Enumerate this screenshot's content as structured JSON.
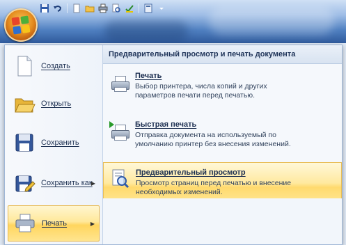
{
  "menu": {
    "items": [
      {
        "label": "Создать",
        "icon": "new-document-icon"
      },
      {
        "label": "Открыть",
        "icon": "open-folder-icon"
      },
      {
        "label": "Сохранить",
        "icon": "save-icon"
      },
      {
        "label": "Сохранить как",
        "icon": "save-as-icon",
        "has_submenu": true
      },
      {
        "label": "Печать",
        "icon": "printer-icon",
        "has_submenu": true,
        "active": true
      }
    ]
  },
  "submenu": {
    "title": "Предварительный просмотр и печать документа",
    "items": [
      {
        "title": "Печать",
        "description": "Выбор принтера, числа копий и других параметров печати перед печатью.",
        "icon": "printer-icon"
      },
      {
        "title": "Быстрая печать",
        "description": "Отправка документа на используемый по умолчанию принтер без внесения изменений.",
        "icon": "quick-print-icon"
      },
      {
        "title": "Предварительный просмотр",
        "description": "Просмотр страниц перед печатью и внесение необходимых изменений.",
        "icon": "print-preview-icon",
        "active": true
      }
    ]
  },
  "colors": {
    "highlight": "#ffe08a",
    "highlight_border": "#e7b84f",
    "title_bar": "#4f7fc0"
  }
}
